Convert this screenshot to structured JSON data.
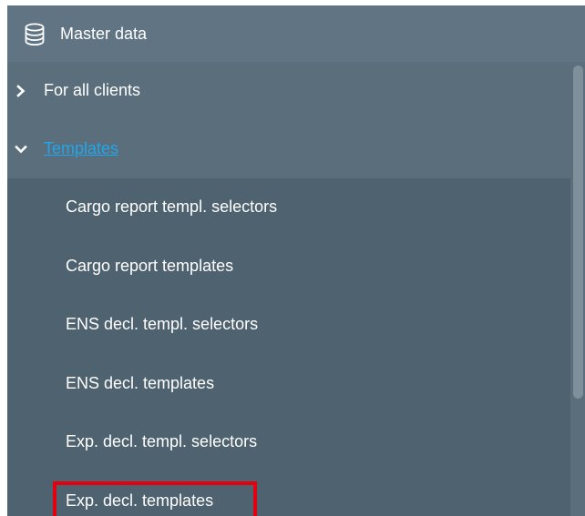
{
  "header": {
    "icon": "database-icon",
    "title": "Master data"
  },
  "menu": {
    "items": [
      {
        "label": "For all clients",
        "icon": "chevron-right-icon",
        "expanded": false
      },
      {
        "label": "Templates",
        "icon": "chevron-down-icon",
        "expanded": true
      }
    ]
  },
  "templates": {
    "items": [
      {
        "label": "Cargo report templ. selectors"
      },
      {
        "label": "Cargo report templates"
      },
      {
        "label": "ENS decl. templ. selectors"
      },
      {
        "label": "ENS decl. templates"
      },
      {
        "label": "Exp. decl. templ. selectors"
      },
      {
        "label": "Exp. decl. templates"
      }
    ],
    "highlighted_label": "Exp. decl. templates"
  },
  "colors": {
    "panel_bg": "#5b6e7b",
    "header_bg": "#607484",
    "submenu_bg": "#4f626f",
    "text": "#ffffff",
    "link": "#1ea7f0",
    "highlight_border": "#e3000f",
    "scroll_thumb": "#7f909b"
  }
}
